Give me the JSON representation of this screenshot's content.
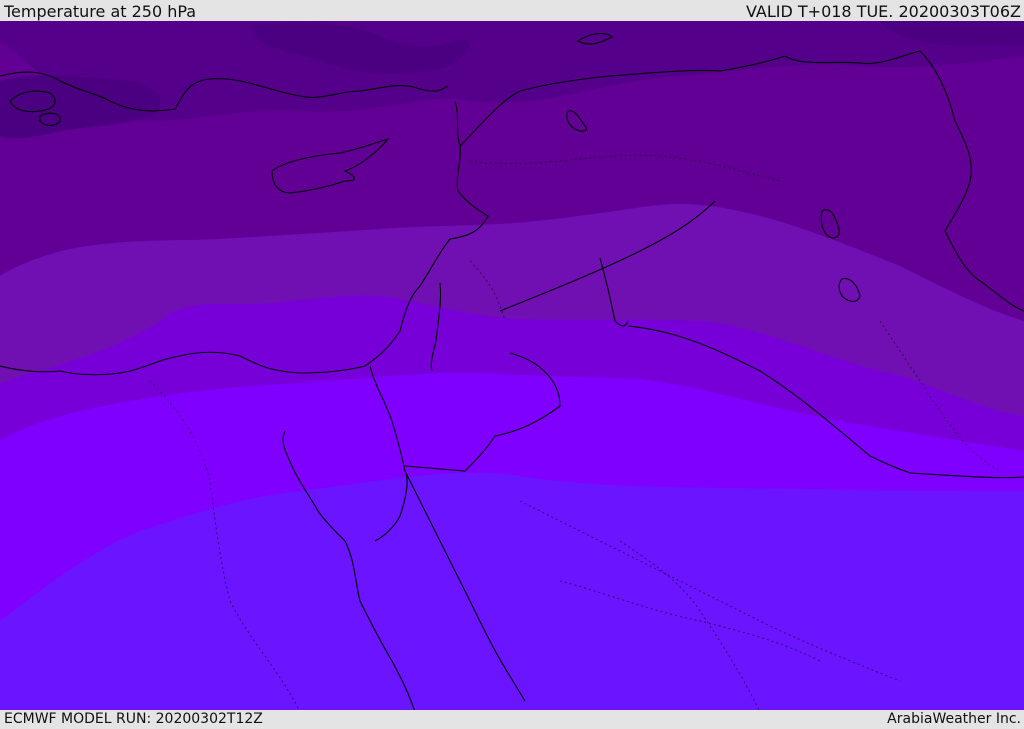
{
  "header": {
    "title": "Temperature at 250 hPa",
    "valid": "VALID T+018 TUE. 20200303T06Z"
  },
  "footer": {
    "model_run": "ECMWF MODEL RUN: 20200302T12Z",
    "credit": "ArabiaWeather Inc."
  },
  "colors": {
    "band_darkest": "#4b0082",
    "band_dark": "#620096",
    "band_mid": "#7010b3",
    "band_violet": "#7700d8",
    "band_bright": "#8000ff",
    "band_blue": "#6a14ff",
    "coastline": "#000000"
  }
}
